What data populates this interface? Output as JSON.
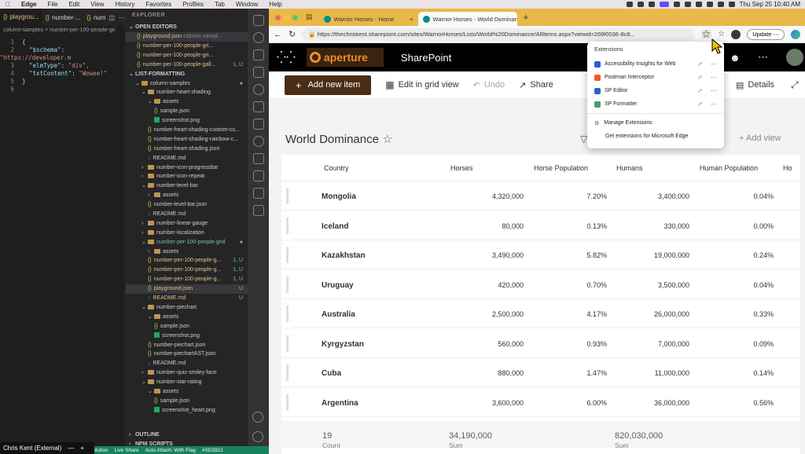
{
  "menubar": {
    "items": [
      "Edge",
      "File",
      "Edit",
      "View",
      "History",
      "Favorites",
      "Profiles",
      "Tab",
      "Window",
      "Help"
    ],
    "clock": "Thu Sep 25  10:40 AM"
  },
  "vscode": {
    "tabs": [
      "playgrou...",
      "number-...",
      "num"
    ],
    "breadcrumb": "column-samples > number-per-100-people-gri",
    "code_lines": [
      {
        "n": "1",
        "text": "{"
      },
      {
        "n": "2",
        "key": "\"$schema\"",
        "val": "\"https://developer.m"
      },
      {
        "n": "3",
        "key": "\"elmType\"",
        "val": "\"div\","
      },
      {
        "n": "4",
        "key": "\"txtContent\"",
        "val": "\"Wowee!\""
      },
      {
        "n": "5",
        "text": "}"
      },
      {
        "n": "6",
        "text": ""
      }
    ],
    "explorer": {
      "title": "EXPLORER",
      "open_editors_label": "OPEN EDITORS",
      "open_editors": [
        {
          "name": "playground.json",
          "detail": "column-sampl...",
          "badge": ""
        },
        {
          "name": "number-per-100-people-gri...",
          "detail": "",
          "badge": ""
        },
        {
          "name": "number-per-100-people-gri...",
          "detail": "",
          "badge": ""
        },
        {
          "name": "number-per-100-people-gall...",
          "detail": "",
          "badge": "1, U"
        }
      ],
      "root_label": "LIST-FORMATTING",
      "tree": [
        {
          "d": 1,
          "t": "folder",
          "name": "column-samples",
          "badge": "●",
          "open": true
        },
        {
          "d": 2,
          "t": "folder",
          "name": "number-heart-shading",
          "open": true
        },
        {
          "d": 3,
          "t": "folder",
          "name": "assets",
          "open": true
        },
        {
          "d": 4,
          "t": "json",
          "name": "sample.json"
        },
        {
          "d": 4,
          "t": "png",
          "name": "screenshot.png"
        },
        {
          "d": 3,
          "t": "json",
          "name": "number-heart-shading-custom-co..."
        },
        {
          "d": 3,
          "t": "json",
          "name": "number-heart-shading-rainbow-c..."
        },
        {
          "d": 3,
          "t": "json",
          "name": "number-heart-shading.json"
        },
        {
          "d": 3,
          "t": "md",
          "name": "README.md"
        },
        {
          "d": 2,
          "t": "folder",
          "name": "number-icon-progressbar"
        },
        {
          "d": 2,
          "t": "folder",
          "name": "number-icon-repeat"
        },
        {
          "d": 2,
          "t": "folder",
          "name": "number-level-bar",
          "open": true
        },
        {
          "d": 3,
          "t": "folder",
          "name": "assets"
        },
        {
          "d": 3,
          "t": "json",
          "name": "number-level-bar.json"
        },
        {
          "d": 3,
          "t": "md",
          "name": "README.md"
        },
        {
          "d": 2,
          "t": "folder",
          "name": "number-linear-gauge"
        },
        {
          "d": 2,
          "t": "folder",
          "name": "number-localization"
        },
        {
          "d": 2,
          "t": "folder",
          "name": "number-per-100-people-grid",
          "badge": "●",
          "open": true,
          "mod": true
        },
        {
          "d": 3,
          "t": "folder",
          "name": "assets"
        },
        {
          "d": 3,
          "t": "json",
          "name": "number-per-100-people-g...",
          "badge": "1, U",
          "mod": true
        },
        {
          "d": 3,
          "t": "json",
          "name": "number-per-100-people-g...",
          "badge": "1, U",
          "mod": true
        },
        {
          "d": 3,
          "t": "json",
          "name": "number-per-100-people-g...",
          "badge": "1, U",
          "mod": true
        },
        {
          "d": 3,
          "t": "json",
          "name": "playground.json",
          "badge": "U",
          "sel": true,
          "mod": true
        },
        {
          "d": 3,
          "t": "md",
          "name": "README.md",
          "badge": "U",
          "mod": true
        },
        {
          "d": 2,
          "t": "folder",
          "name": "number-piechart",
          "open": true
        },
        {
          "d": 3,
          "t": "folder",
          "name": "assets",
          "open": true
        },
        {
          "d": 4,
          "t": "json",
          "name": "sample.json"
        },
        {
          "d": 4,
          "t": "png",
          "name": "screenshot.png"
        },
        {
          "d": 3,
          "t": "json",
          "name": "number-piechart.json"
        },
        {
          "d": 3,
          "t": "json",
          "name": "number-piechartAST.json"
        },
        {
          "d": 3,
          "t": "md",
          "name": "README.md"
        },
        {
          "d": 2,
          "t": "folder",
          "name": "number-quiz-smiley-face"
        },
        {
          "d": 2,
          "t": "folder",
          "name": "number-star-rating",
          "open": true
        },
        {
          "d": 3,
          "t": "folder",
          "name": "assets",
          "open": true
        },
        {
          "d": 4,
          "t": "json",
          "name": "sample.json"
        },
        {
          "d": 4,
          "t": "png",
          "name": "screenshot_heart.png"
        }
      ],
      "outline_label": "OUTLINE",
      "npm_label": "NPM SCRIPTS"
    },
    "statusbar": [
      "Solution",
      "Live Share",
      "Auto Attach: With Flag",
      "#SD2821"
    ],
    "zoom_participant": "Chris Kent (External)"
  },
  "browser": {
    "tabs": [
      {
        "label": "Warrior Horses - Home",
        "active": false
      },
      {
        "label": "Warrior Horses - World Dominan",
        "active": true
      }
    ],
    "new_tab": "+",
    "url": "https://thechriskent.sharepoint.com/sites/WarriorHorses/Lists/World%20Dominance/AllItems.aspx?viewid=269f0036-8c8...",
    "update_label": "Update"
  },
  "sharepoint": {
    "logo_text": "aperture",
    "suite_title": "SharePoint",
    "commands": {
      "add_item": "Add new item",
      "grid_view": "Edit in grid view",
      "undo": "Undo",
      "share": "Share",
      "details": "Details"
    },
    "list_title": "World Dominance",
    "add_view": "Add view",
    "columns": [
      "Country",
      "Horses",
      "Horse Population",
      "Humans",
      "Human Population",
      "Ho"
    ],
    "rows": [
      {
        "country": "Mongolia",
        "horses": "4,320,000",
        "horse_pop": "7.20%",
        "humans": "3,400,000",
        "human_pop": "0.04%"
      },
      {
        "country": "Iceland",
        "horses": "80,000",
        "horse_pop": "0.13%",
        "humans": "330,000",
        "human_pop": "0.00%"
      },
      {
        "country": "Kazakhstan",
        "horses": "3,490,000",
        "horse_pop": "5.82%",
        "humans": "19,000,000",
        "human_pop": "0.24%"
      },
      {
        "country": "Uruguay",
        "horses": "420,000",
        "horse_pop": "0.70%",
        "humans": "3,500,000",
        "human_pop": "0.04%"
      },
      {
        "country": "Australia",
        "horses": "2,500,000",
        "horse_pop": "4.17%",
        "humans": "26,000,000",
        "human_pop": "0.33%"
      },
      {
        "country": "Kyrgyzstan",
        "horses": "560,000",
        "horse_pop": "0.93%",
        "humans": "7,000,000",
        "human_pop": "0.09%"
      },
      {
        "country": "Cuba",
        "horses": "880,000",
        "horse_pop": "1.47%",
        "humans": "11,000,000",
        "human_pop": "0.14%"
      },
      {
        "country": "Argentina",
        "horses": "3,600,000",
        "horse_pop": "6.00%",
        "humans": "36,000,000",
        "human_pop": "0.56%"
      }
    ],
    "footer": {
      "count_label": "Count",
      "count_value": "19",
      "sum1_label": "Sum",
      "sum1_value": "34,190,000",
      "sum2_label": "Sum",
      "sum2_value": "820,030,000"
    }
  },
  "extensions_popup": {
    "title": "Extensions",
    "items": [
      {
        "name": "Accessibility Insights for Web",
        "color": "#2b5bd7"
      },
      {
        "name": "Postman Interceptor",
        "color": "#ef5b25"
      },
      {
        "name": "SP Editor",
        "color": "#2266cc"
      },
      {
        "name": "SP Formatter",
        "color": "#4a9a6a"
      }
    ],
    "manage": "Manage Extensions",
    "get": "Get extensions for Microsoft Edge"
  },
  "colors": {
    "tabstrip": "#e9b84a",
    "sp_brown": "#4a2d14",
    "aperture_orange": "#f28c28",
    "vscode_bg": "#1e1e1e",
    "status_green": "#16825d"
  }
}
